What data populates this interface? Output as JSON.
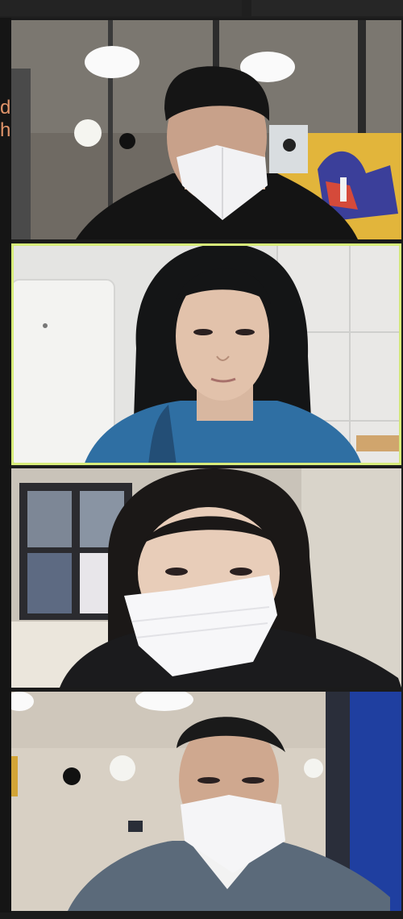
{
  "app": {
    "title": "",
    "shared_screen_text": [
      "d",
      "h"
    ]
  },
  "gallery": {
    "participants": [
      {
        "name": "",
        "role": "participant",
        "speaking": false
      },
      {
        "name": "",
        "role": "participant",
        "speaking": true
      },
      {
        "name": "",
        "role": "participant",
        "speaking": false
      },
      {
        "name": "",
        "role": "participant",
        "speaking": false
      }
    ],
    "active_speaker_color": "#d7ec7a"
  }
}
